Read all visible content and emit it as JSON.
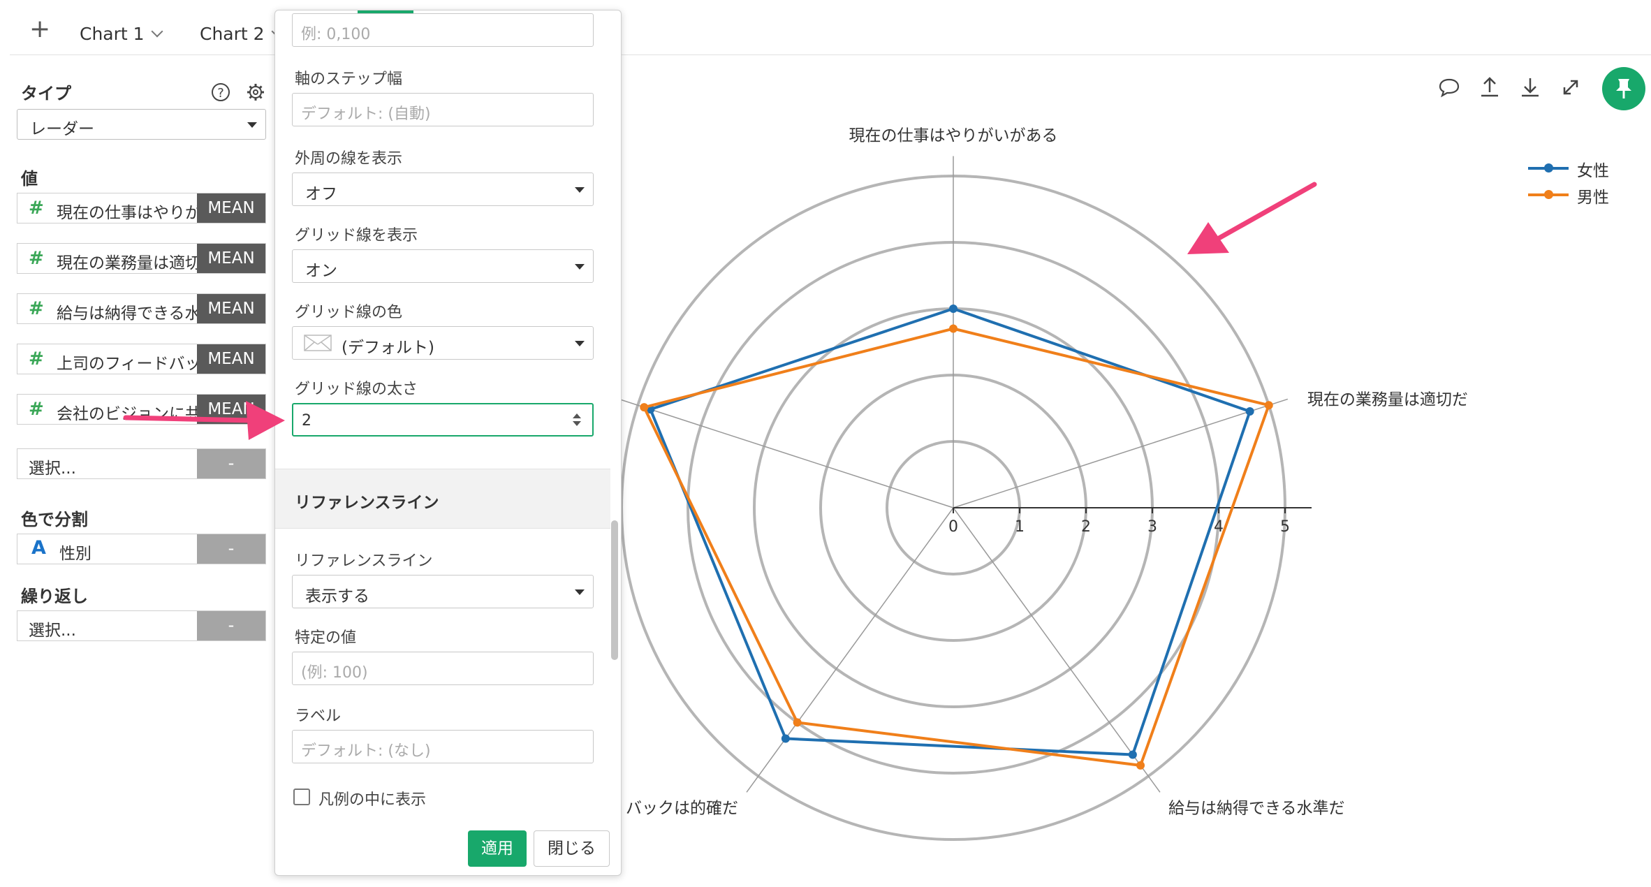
{
  "tabs": {
    "add_label": "+",
    "items": [
      {
        "label": "Chart 1"
      },
      {
        "label": "Chart 2"
      }
    ]
  },
  "left_panel": {
    "type_label": "タイプ",
    "type_value": "レーダー",
    "values_label": "値",
    "values": [
      {
        "text": "現在の仕事はやりがいがある",
        "agg": "MEAN"
      },
      {
        "text": "現在の業務量は適切だ",
        "agg": "MEAN"
      },
      {
        "text": "給与は納得できる水準だ",
        "agg": "MEAN"
      },
      {
        "text": "上司のフィードバックは的確だ",
        "agg": "MEAN"
      },
      {
        "text": "会社のビジョンに共感できる",
        "agg": "MEAN"
      }
    ],
    "select_placeholder": "選択...",
    "minus_label": "-",
    "color_label": "色で分割",
    "color_value": "性別",
    "color_type_icon": "A",
    "repeat_label": "繰り返し",
    "repeat_value": "選択..."
  },
  "popup": {
    "range_placeholder": "例: 0,100",
    "step_label": "軸のステップ幅",
    "step_placeholder": "デフォルト: (自動)",
    "outer_line_label": "外周の線を表示",
    "outer_line_value": "オフ",
    "grid_show_label": "グリッド線を表示",
    "grid_show_value": "オン",
    "grid_color_label": "グリッド線の色",
    "grid_color_value": "(デフォルト)",
    "grid_width_label": "グリッド線の太さ",
    "grid_width_value": "2",
    "refline_header": "リファレンスライン",
    "refline_label": "リファレンスライン",
    "refline_value": "表示する",
    "specific_value_label": "特定の値",
    "specific_value_placeholder": "(例: 100)",
    "ref_label_label": "ラベル",
    "ref_label_placeholder": "デフォルト: (なし)",
    "legend_checkbox_label": "凡例の中に表示",
    "apply_label": "適用",
    "close_label": "閉じる"
  },
  "colors": {
    "female": "#1f6fb0",
    "male": "#f07f1a",
    "accent_green": "#18a86b",
    "annotation_pink": "#f0407a"
  },
  "icons": [
    "plus-icon",
    "chevron-down-icon",
    "help-icon",
    "gear-icon",
    "comment-icon",
    "upload-icon",
    "download-icon",
    "expand-icon",
    "pin-icon",
    "arrow-annotation"
  ],
  "chart_data": {
    "type": "radar",
    "axes": [
      "現在の仕事はやりがいがある",
      "現在の業務量は適切だ",
      "給与は納得できる水準だ",
      "上司のフィードバックは的確だ",
      "会社のビジョンに共感できる"
    ],
    "axis_labels_visible": [
      "現在の仕事はやりがいがある",
      "現在の業務量は適切だ",
      "給与は納得できる水準だ",
      "バックは的確だ"
    ],
    "ticks": [
      0,
      1,
      2,
      3,
      4,
      5
    ],
    "rlim": [
      0,
      5
    ],
    "grid": true,
    "outer_line": false,
    "legend_position": "top-right",
    "series": [
      {
        "name": "女性",
        "values": [
          3.0,
          4.7,
          4.6,
          4.3,
          4.8
        ]
      },
      {
        "name": "男性",
        "values": [
          2.7,
          5.0,
          4.8,
          4.0,
          4.9
        ]
      }
    ]
  }
}
